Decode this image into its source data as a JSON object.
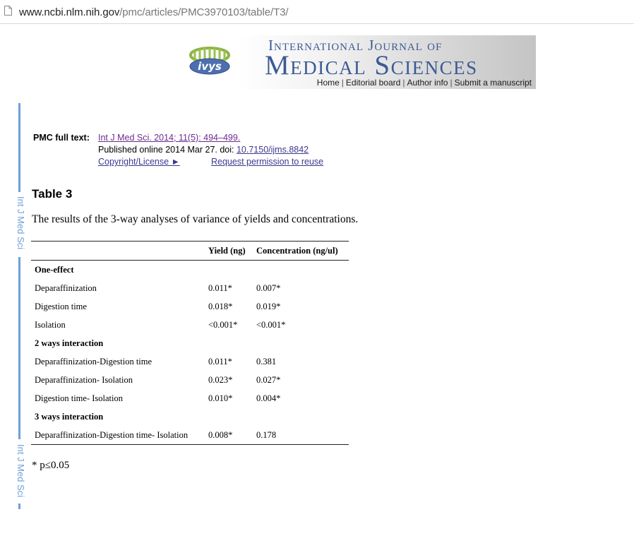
{
  "browser": {
    "url_host": "www.ncbi.nlm.nih.gov",
    "url_path": "/pmc/articles/PMC3970103/table/T3/",
    "page_icon": "page-icon"
  },
  "banner": {
    "logo_text": "ivys",
    "journal_line1": "International Journal of",
    "journal_line2": "Medical Sciences",
    "nav": [
      "Home",
      "Editorial board",
      "Author info",
      "Submit a manuscript"
    ],
    "title_color": "#3d5a94"
  },
  "side_label": "Int J Med Sci",
  "pmc": {
    "label": "PMC full text:",
    "citation": "Int J Med Sci. 2014; 11(5): 494–499.",
    "published": "Published online 2014 Mar 27. doi: ",
    "doi": "10.7150/ijms.8842",
    "copyright": "Copyright/License ►",
    "permission": "Request permission to reuse"
  },
  "table_title": "Table 3",
  "caption": "The results of the 3-way analyses of variance of yields and concentrations.",
  "table": {
    "headers": [
      "",
      "Yield (ng)",
      "Concentration (ng/ul)"
    ],
    "rows": [
      {
        "section": "One-effect"
      },
      {
        "label": "Deparaffinization",
        "yield": "0.011*",
        "conc": "0.007*"
      },
      {
        "label": "Digestion time",
        "yield": "0.018*",
        "conc": "0.019*"
      },
      {
        "label": "Isolation",
        "yield": "<0.001*",
        "conc": "<0.001*"
      },
      {
        "section": "2 ways interaction"
      },
      {
        "label": "Deparaffinization-Digestion time",
        "yield": "0.011*",
        "conc": "0.381"
      },
      {
        "label": "Deparaffinization- Isolation",
        "yield": "0.023*",
        "conc": "0.027*"
      },
      {
        "label": "Digestion time- Isolation",
        "yield": "0.010*",
        "conc": "0.004*"
      },
      {
        "section": "3 ways interaction"
      },
      {
        "label": "Deparaffinization-Digestion time- Isolation",
        "yield": "0.008*",
        "conc": "0.178"
      }
    ]
  },
  "footnote": "* p≤0.05",
  "colors": {
    "accent_blue": "#6f9fd8",
    "link": "#3b3a8f",
    "visited_link": "#6b2c8e"
  }
}
